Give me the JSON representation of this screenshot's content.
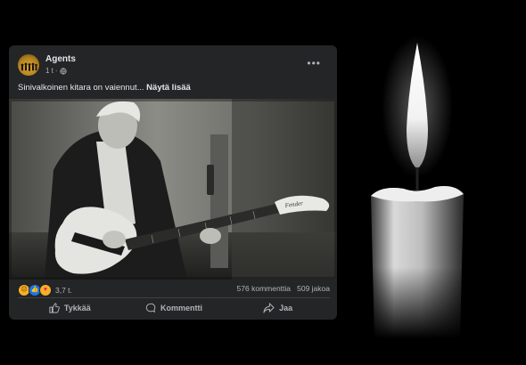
{
  "post": {
    "author": "Agents",
    "time": "1 t",
    "text": "Sinivalkoinen kitara on vaiennut...",
    "see_more": "Näytä lisää",
    "guitar_brand": "Fender",
    "reactions": {
      "icons": [
        "sad-icon",
        "like-icon",
        "care-icon"
      ],
      "count": "3,7 t."
    },
    "comments": "576 kommenttia",
    "shares": "509 jakoa",
    "actions": {
      "like": "Tykkää",
      "comment": "Kommentti",
      "share": "Jaa"
    }
  },
  "colors": {
    "card_bg": "#242526",
    "text_primary": "#e4e6eb",
    "text_secondary": "#b0b3b8",
    "page_bg": "#000000"
  }
}
